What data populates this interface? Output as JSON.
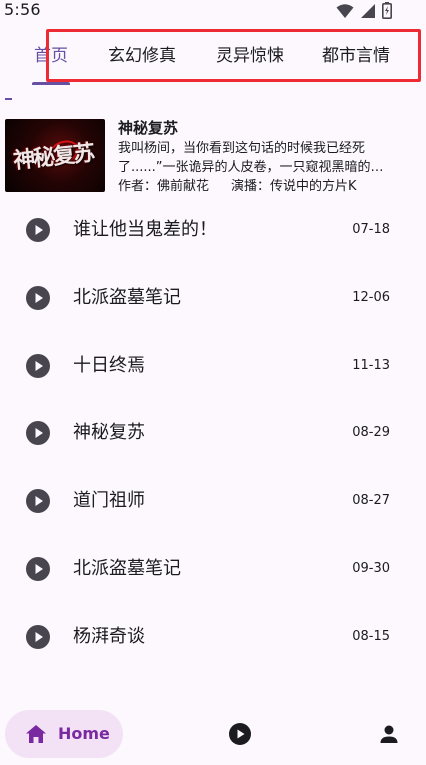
{
  "status_bar": {
    "time": "5:56",
    "icons": [
      "wifi-icon",
      "cellular-signal-icon",
      "battery-charging-icon"
    ]
  },
  "tabs": [
    {
      "label": "首页",
      "active": true
    },
    {
      "label": "玄幻修真",
      "active": false
    },
    {
      "label": "灵异惊悚",
      "active": false
    },
    {
      "label": "都市言情",
      "active": false
    }
  ],
  "colors": {
    "accent": "#6750a4",
    "highlight_box": "#ee2a33",
    "home_pill": "#f3e1f6",
    "home_label": "#7a2aa0",
    "icon_dark": "#49454f"
  },
  "featured": {
    "cover_text": "神秘复苏",
    "title": "神秘复苏",
    "description": "我叫杨间，当你看到这句话的时候我已经死了......”一张诡异的人皮卷，一只窥视黑暗的…",
    "author_label": "作者：佛前献花",
    "narrator_label": "演播：传说中的方片K"
  },
  "list": [
    {
      "title": "谁让他当鬼差的！",
      "date": "07-18"
    },
    {
      "title": "北派盗墓笔记",
      "date": "12-06"
    },
    {
      "title": "十日终焉",
      "date": "11-13"
    },
    {
      "title": "神秘复苏",
      "date": "08-29"
    },
    {
      "title": "道门祖师",
      "date": "08-27"
    },
    {
      "title": "北派盗墓笔记",
      "date": "09-30"
    },
    {
      "title": "杨湃奇谈",
      "date": "08-15"
    }
  ],
  "bottom_nav": {
    "home_label": "Home",
    "icons": [
      "home-icon",
      "play-circle-icon",
      "person-icon"
    ]
  }
}
